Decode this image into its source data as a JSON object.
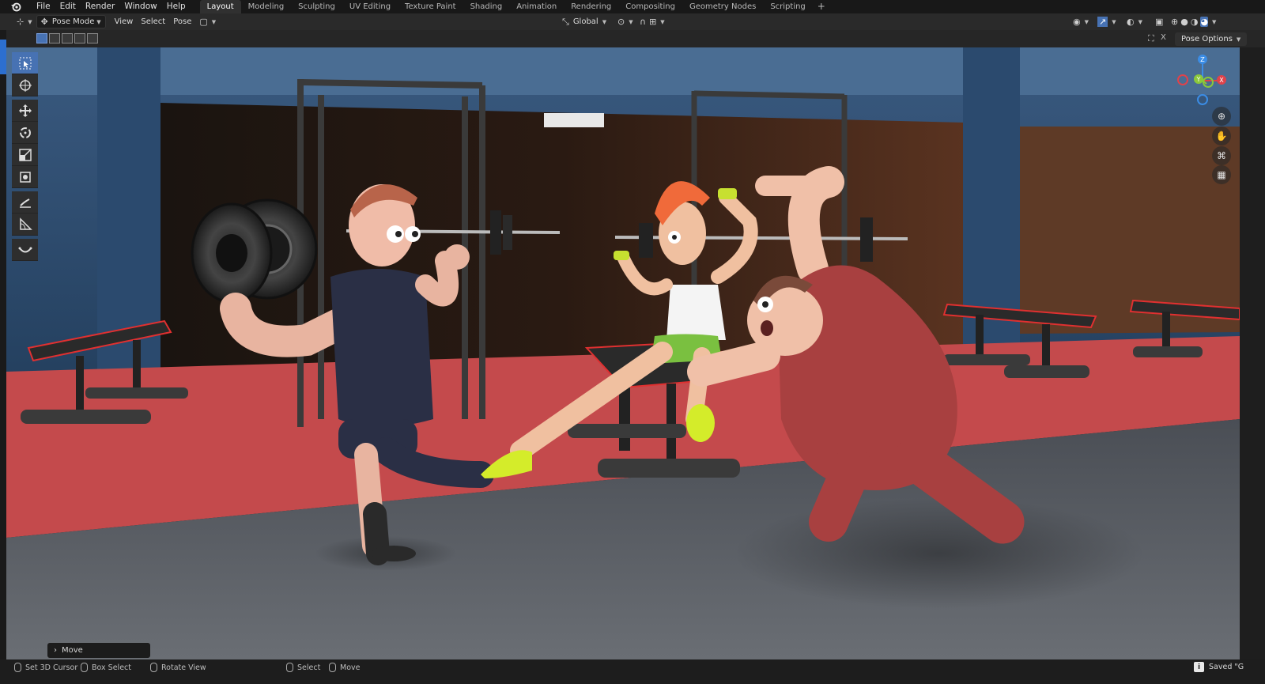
{
  "menu": {
    "items": [
      "File",
      "Edit",
      "Render",
      "Window",
      "Help"
    ]
  },
  "workspaces": {
    "tabs": [
      "Layout",
      "Modeling",
      "Sculpting",
      "UV Editing",
      "Texture Paint",
      "Shading",
      "Animation",
      "Rendering",
      "Compositing",
      "Geometry Nodes",
      "Scripting"
    ],
    "active": "Layout",
    "add_label": "+"
  },
  "header": {
    "mode": "Pose Mode",
    "view": "View",
    "select": "Select",
    "pose": "Pose",
    "orientation": "Global"
  },
  "viewport": {
    "pose_options": "Pose Options",
    "last_operator": "Move"
  },
  "gizmo": {
    "x": "X",
    "y": "Y",
    "z": "Z",
    "colors": {
      "x": "#e0424a",
      "y": "#8bc83a",
      "z": "#3b8de6"
    }
  },
  "status": {
    "items": [
      "Set 3D Cursor",
      "Box Select",
      "Rotate View",
      "Select",
      "Move"
    ],
    "saved": "Saved \"G"
  },
  "colors": {
    "accent": "#4772b3",
    "floor_mat": "#c84a4c",
    "floor": "#52565c",
    "wall": "#2f4f72"
  }
}
